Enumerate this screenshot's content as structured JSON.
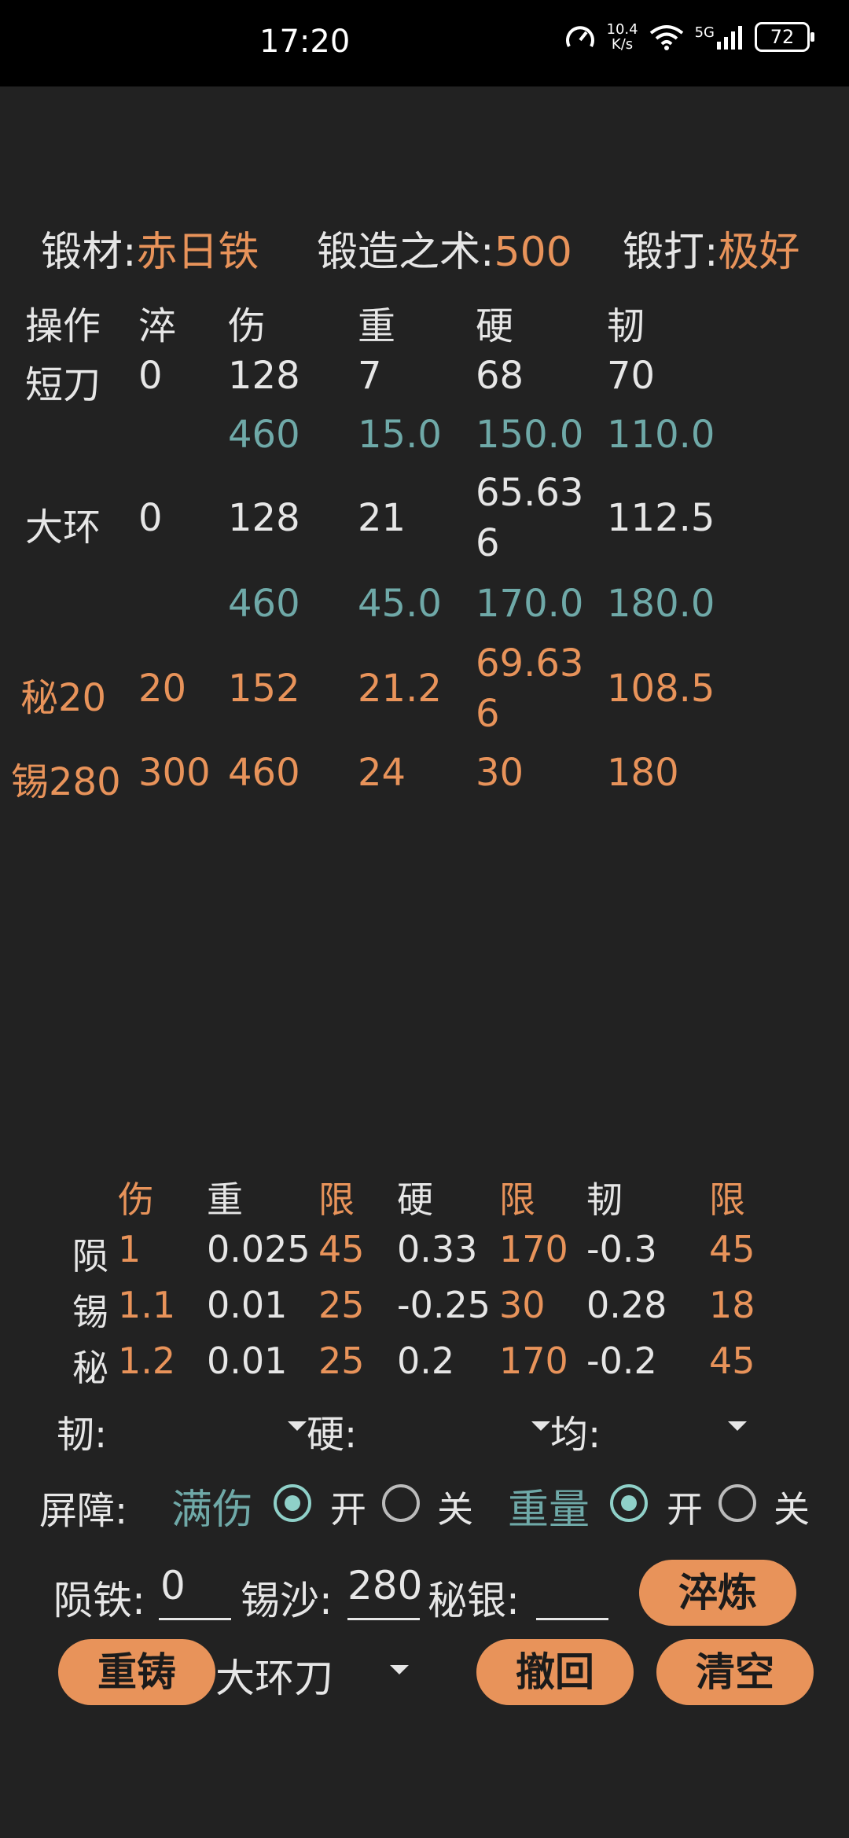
{
  "status_bar": {
    "time": "17:20",
    "net_speed_top": "10.4",
    "net_speed_bottom": "K/s",
    "network": "5G",
    "battery": "72"
  },
  "info": {
    "material_label": "锻材:",
    "material_value": "赤日铁",
    "skill_label": "锻造之术:",
    "skill_value": "500",
    "forge_label": "锻打:",
    "forge_value": "极好"
  },
  "table": {
    "headers": [
      "操作",
      "淬",
      "伤",
      "重",
      "硬",
      "韧"
    ],
    "rows": [
      {
        "op": "短刀",
        "cui": "0",
        "shang": "128",
        "zhong": "7",
        "ying": "68",
        "ren": "70"
      },
      {
        "shang": "460",
        "zhong": "15.0",
        "ying": "150.0",
        "ren": "110.0"
      },
      {
        "op": "大环",
        "cui": "0",
        "shang": "128",
        "zhong": "21",
        "ying_l1": "65.63",
        "ying_l2": "6",
        "ren": "112.5"
      },
      {
        "shang": "460",
        "zhong": "45.0",
        "ying": "170.0",
        "ren": "180.0"
      },
      {
        "op": "秘20",
        "cui": "20",
        "shang": "152",
        "zhong": "21.2",
        "ying_l1": "69.63",
        "ying_l2": "6",
        "ren": "108.5"
      },
      {
        "op": "锡280",
        "cui": "300",
        "shang": "460",
        "zhong": "24",
        "ying": "30",
        "ren": "180"
      }
    ]
  },
  "coef_table": {
    "headers": [
      "伤",
      "重",
      "限",
      "硬",
      "限",
      "韧",
      "限"
    ],
    "rows": [
      {
        "name": "陨",
        "shang": "1",
        "zhong": "0.025",
        "lim1": "45",
        "ying": "0.33",
        "lim2": "170",
        "ren": "-0.3",
        "lim3": "45"
      },
      {
        "name": "锡",
        "shang": "1.1",
        "zhong": "0.01",
        "lim1": "25",
        "ying": "-0.25",
        "lim2": "30",
        "ren": "0.28",
        "lim3": "18"
      },
      {
        "name": "秘",
        "shang": "1.2",
        "zhong": "0.01",
        "lim1": "25",
        "ying": "0.2",
        "lim2": "170",
        "ren": "-0.2",
        "lim3": "45"
      }
    ]
  },
  "selectors": {
    "ren_label": "韧:",
    "ying_label": "硬:",
    "jun_label": "均:"
  },
  "barrier": {
    "label": "屏障:",
    "full_damage": "满伤",
    "weight": "重量",
    "on": "开",
    "off": "关"
  },
  "inputs": {
    "meteor_label": "陨铁:",
    "meteor_value": "0",
    "tin_label": "锡沙:",
    "tin_value": "280",
    "silver_label": "秘银:",
    "silver_value": ""
  },
  "buttons": {
    "quench": "淬炼",
    "recast": "重铸",
    "undo": "撤回",
    "clear": "清空"
  },
  "weapon_select": {
    "value": "大环刀"
  },
  "colors": {
    "accent": "#e8935a",
    "teal": "#6fa9a8",
    "radio": "#8fd0c8",
    "background": "#222222"
  }
}
